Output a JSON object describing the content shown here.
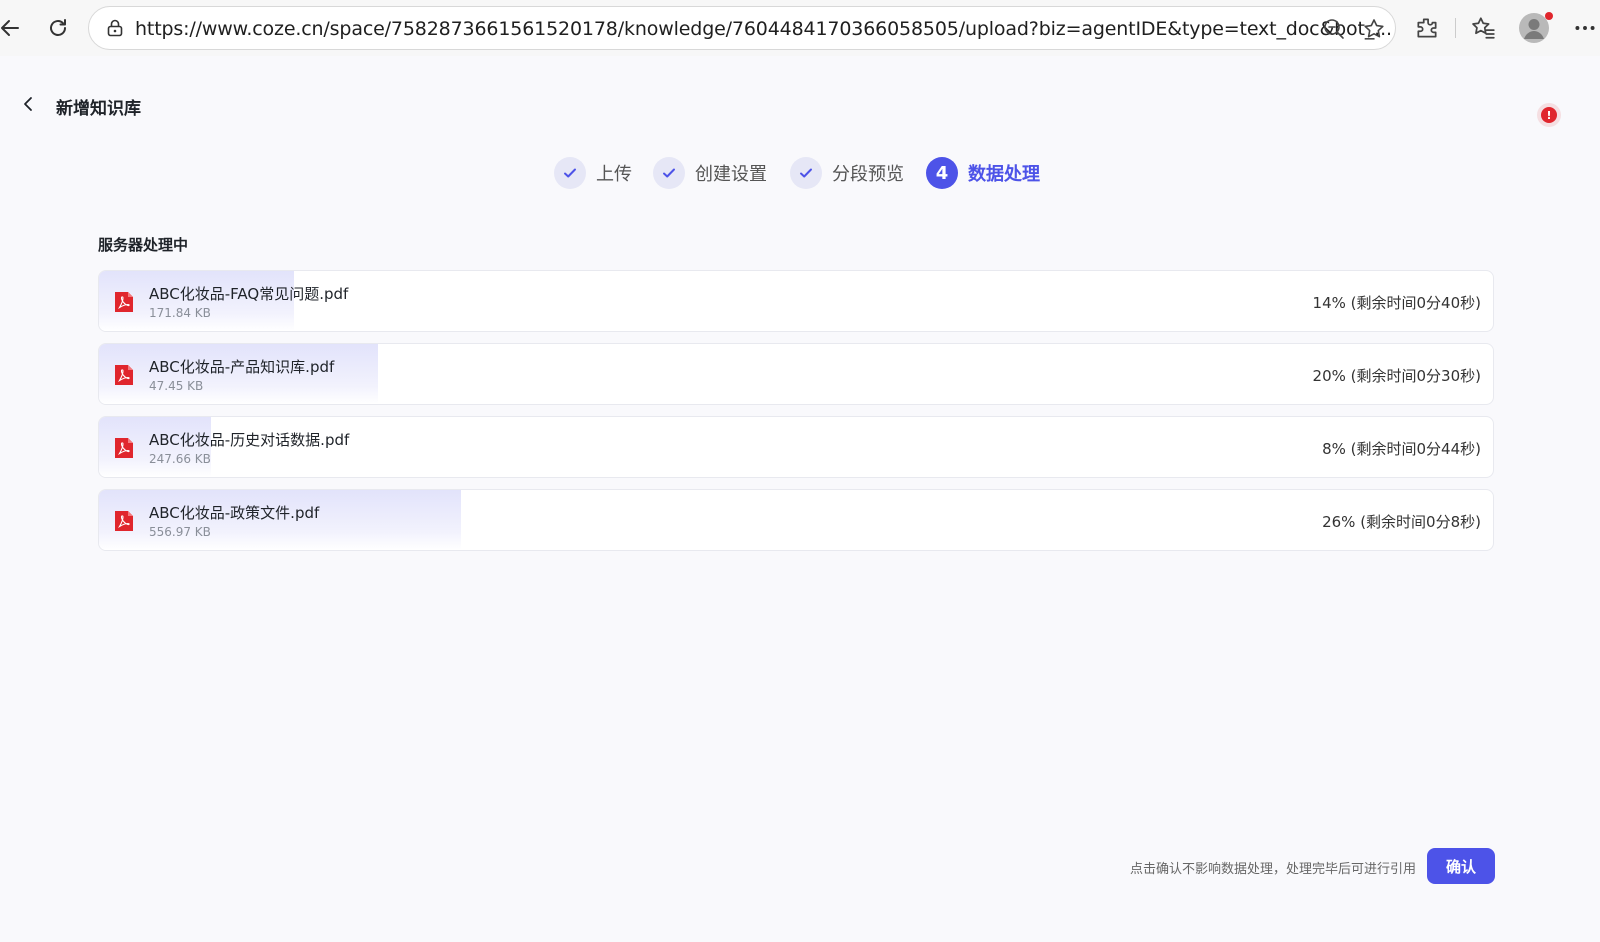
{
  "browser": {
    "url": "https://www.coze.cn/space/7582873661561520178/knowledge/7604484170366058505/upload?biz=agentIDE&type=text_doc&bot_..."
  },
  "page": {
    "title": "新增知识库",
    "alert_badge": "!"
  },
  "steps": [
    {
      "label": "上传",
      "state": "done"
    },
    {
      "label": "创建设置",
      "state": "done"
    },
    {
      "label": "分段预览",
      "state": "done"
    },
    {
      "label": "数据处理",
      "state": "active",
      "number": "4"
    }
  ],
  "processing": {
    "title": "服务器处理中",
    "files": [
      {
        "name": "ABC化妆品-FAQ常见问题.pdf",
        "size": "171.84 KB",
        "status": "14% (剩余时间0分40秒)",
        "progress": 14
      },
      {
        "name": "ABC化妆品-产品知识库.pdf",
        "size": "47.45 KB",
        "status": "20% (剩余时间0分30秒)",
        "progress": 20
      },
      {
        "name": "ABC化妆品-历史对话数据.pdf",
        "size": "247.66 KB",
        "status": "8% (剩余时间0分44秒)",
        "progress": 8
      },
      {
        "name": "ABC化妆品-政策文件.pdf",
        "size": "556.97 KB",
        "status": "26% (剩余时间0分8秒)",
        "progress": 26
      }
    ]
  },
  "footer": {
    "hint": "点击确认不影响数据处理，处理完毕后可进行引用",
    "confirm_label": "确认"
  },
  "colors": {
    "accent": "#4d53e8",
    "pdf_red": "#e0262d",
    "progress_fill": "#e2e3fb"
  }
}
